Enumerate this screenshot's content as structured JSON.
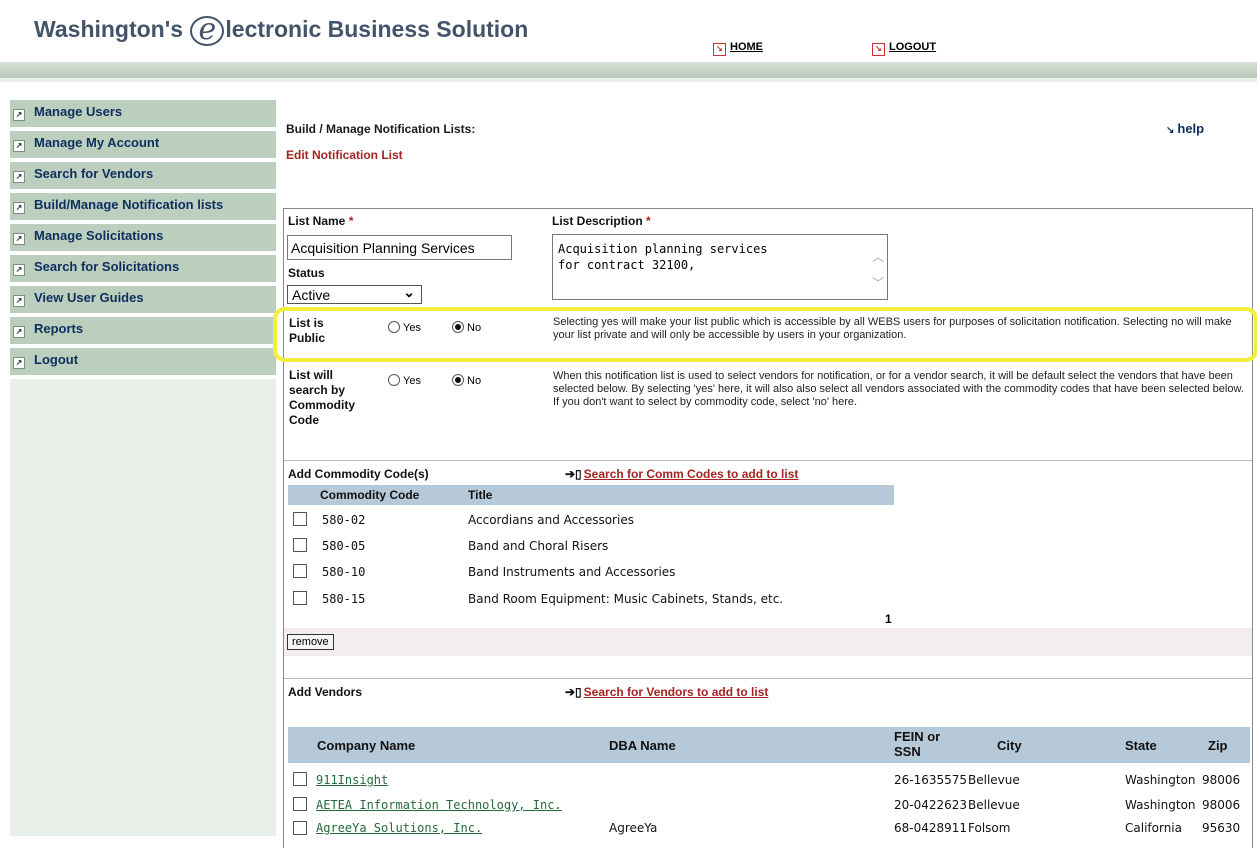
{
  "header": {
    "title_pre": "Washington's",
    "title_logo_letter": "e",
    "title_post": "lectronic Business Solution",
    "home_label": "HOME",
    "logout_label": "LOGOUT"
  },
  "sidebar": {
    "items": [
      {
        "label": "Manage Users"
      },
      {
        "label": "Manage My Account"
      },
      {
        "label": "Search for Vendors"
      },
      {
        "label": "Build/Manage Notification lists"
      },
      {
        "label": "Manage Solicitations"
      },
      {
        "label": "Search for Solicitations"
      },
      {
        "label": "View User Guides"
      },
      {
        "label": "Reports"
      },
      {
        "label": "Logout"
      }
    ]
  },
  "page": {
    "title": "Build / Manage Notification Lists:",
    "subtitle": "Edit Notification List",
    "help_label": "help"
  },
  "form": {
    "list_name_label": "List Name",
    "required_mark": "*",
    "list_name_value": "Acquisition Planning Services",
    "list_desc_label": "List Description",
    "list_desc_value": "Acquisition planning services\nfor contract 32100,",
    "status_label": "Status",
    "status_value": "Active",
    "public_label_1": "List is",
    "public_label_2": "Public",
    "yes_label": "Yes",
    "no_label": "No",
    "public_desc": "Selecting yes will make your list public which is accessible by all WEBS users for purposes of solicitation notification. Selecting no will make your list private and will only be accessible by users in your organization.",
    "commodity_label_1": "List will",
    "commodity_label_2": "search by",
    "commodity_label_3": "Commodity",
    "commodity_label_4": "Code",
    "commodity_desc": "When this notification list is used to select vendors for notification, or for a vendor search, it will be default select the vendors that have been selected below. By selecting 'yes' here, it will also also select all vendors associated with the commodity codes that have been selected below. If you don't want to select by commodity code, select 'no' here."
  },
  "commodities": {
    "header": "Add Commodity Code(s)",
    "search_link": "Search for Comm Codes to add to list",
    "col_code": "Commodity Code",
    "col_title": "Title",
    "rows": [
      {
        "code": "580-02",
        "title": "Accordians and Accessories"
      },
      {
        "code": "580-05",
        "title": "Band and Choral Risers"
      },
      {
        "code": "580-10",
        "title": "Band Instruments and Accessories"
      },
      {
        "code": "580-15",
        "title": "Band Room Equipment: Music Cabinets, Stands, etc."
      }
    ],
    "page_number": "1",
    "remove_label": "remove"
  },
  "vendors": {
    "header": "Add Vendors",
    "search_link": "Search for Vendors to add to list",
    "col_company": "Company Name",
    "col_dba": "DBA Name",
    "col_fein_1": "FEIN or",
    "col_fein_2": "SSN",
    "col_city": "City",
    "col_state": "State",
    "col_zip": "Zip",
    "rows": [
      {
        "company": "911Insight",
        "dba": "",
        "fein": "26-1635575",
        "city": "Bellevue",
        "state": "Washington",
        "zip": "98006"
      },
      {
        "company": "AETEA Information Technology, Inc.",
        "dba": "",
        "fein": "20-0422623",
        "city": "Bellevue",
        "state": "Washington",
        "zip": "98006"
      },
      {
        "company": "AgreeYa Solutions, Inc.",
        "dba": "AgreeYa",
        "fein": "68-0428911",
        "city": "Folsom",
        "state": "California",
        "zip": "95630"
      }
    ]
  },
  "colors": {
    "accent_red": "#a42323",
    "nav_bg": "#bccfbe",
    "table_header_bg": "#b6c9d8",
    "highlight": "#f5ed3c"
  }
}
